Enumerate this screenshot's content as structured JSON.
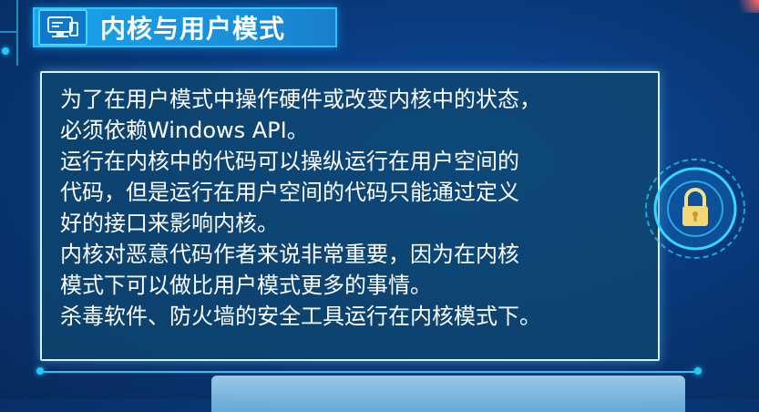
{
  "slide": {
    "title": "内核与用户模式",
    "title_icon": "monitor-icon",
    "lines": [
      "为了在用户模式中操作硬件或改变内核中的状态，",
      "必须依赖Windows API。",
      "运行在内核中的代码可以操纵运行在用户空间的",
      "代码，但是运行在用户空间的代码只能通过定义",
      "好的接口来影响内核。",
      "内核对恶意代码作者来说非常重要，因为在内核",
      "模式下可以做比用户模式更多的事情。",
      "杀毒软件、防火墙的安全工具运行在内核模式下。"
    ],
    "lock_icon": "padlock-icon",
    "colors": {
      "background": "#093a7c",
      "accent": "#27c7f5",
      "banner": "#1aa3e8",
      "text": "#ffffff"
    }
  }
}
